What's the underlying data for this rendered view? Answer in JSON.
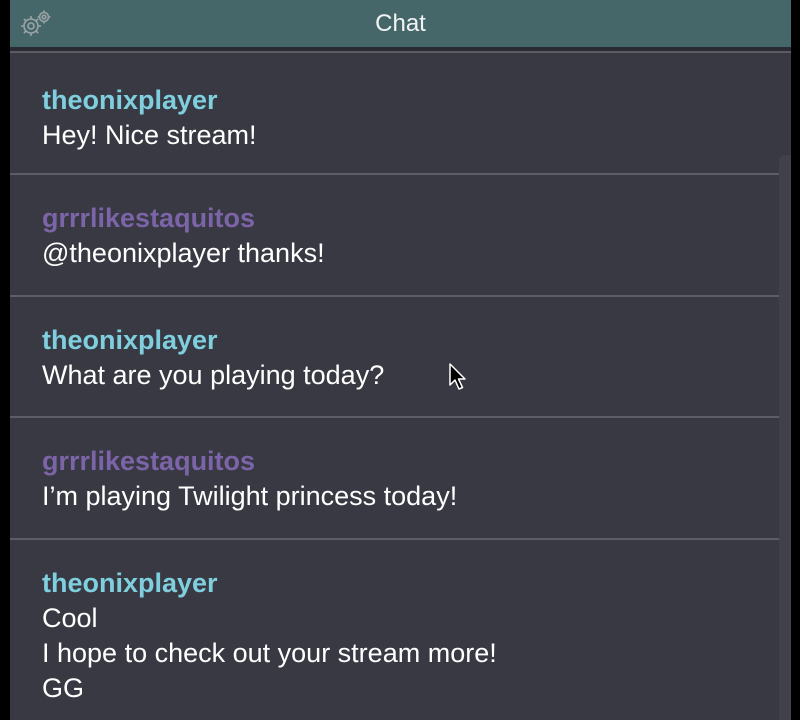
{
  "header": {
    "title": "Chat",
    "settings_icon": "gear-icon"
  },
  "colors": {
    "header_bg": "#46676a",
    "panel_bg": "#383942",
    "user_a": "#7fcfdf",
    "user_b": "#7b64a8",
    "text": "#ffffff"
  },
  "messages": [
    {
      "user": "theonixplayer",
      "lines": [
        "Hey! Nice stream!"
      ]
    },
    {
      "user": "grrrlikestaquitos",
      "lines": [
        "@theonixplayer thanks!"
      ]
    },
    {
      "user": "theonixplayer",
      "lines": [
        "What are you playing today?"
      ]
    },
    {
      "user": "grrrlikestaquitos",
      "lines": [
        "I’m playing Twilight princess today!"
      ]
    },
    {
      "user": "theonixplayer",
      "lines": [
        "Cool",
        "I hope to check out your stream more!",
        "GG"
      ]
    }
  ]
}
